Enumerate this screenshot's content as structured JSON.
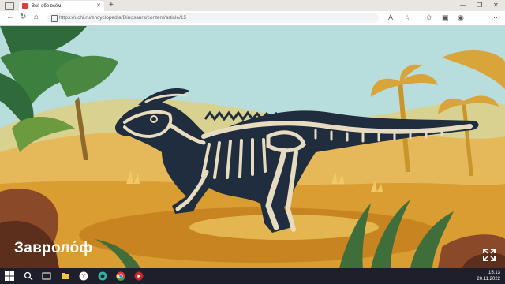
{
  "browser": {
    "tab_title": "Всё обо всём",
    "url": "https://uchi.ru/encyclopedia/Dinosaurs/content/article/15"
  },
  "article": {
    "title": "Завроло́ф"
  },
  "taskbar": {
    "time": "15:13",
    "date": "20.11.2022"
  }
}
